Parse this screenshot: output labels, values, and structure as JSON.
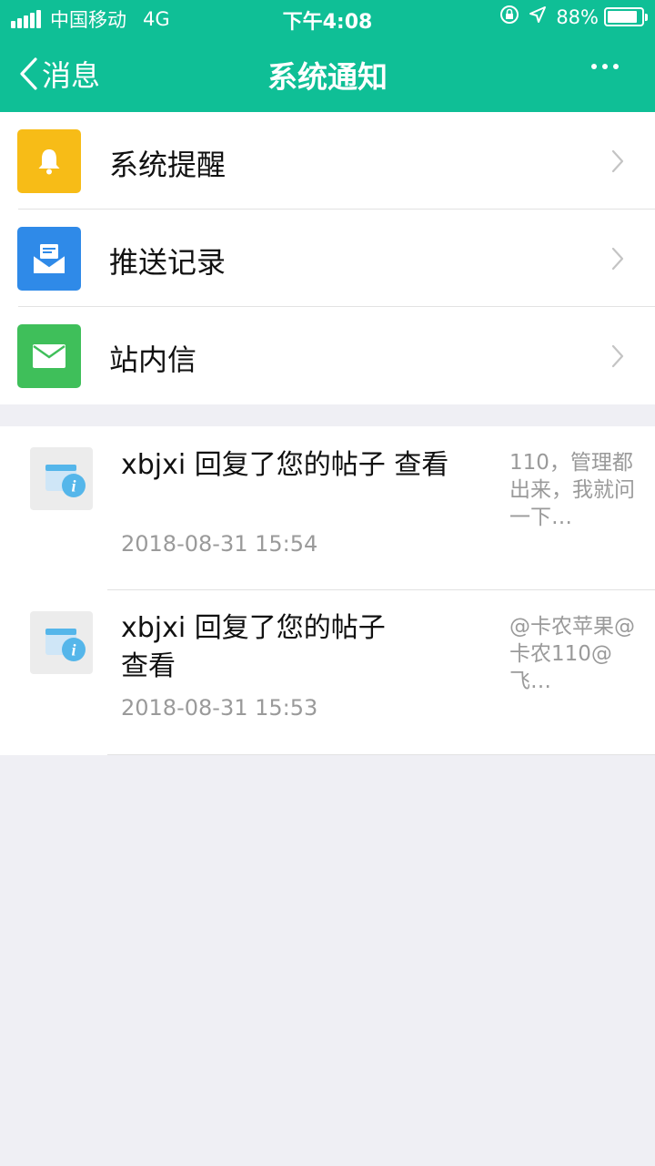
{
  "status_bar": {
    "carrier": "中国移动",
    "network": "4G",
    "time": "下午4:08",
    "battery_text": "88%",
    "battery_level": 0.88
  },
  "nav": {
    "back_label": "消息",
    "title": "系统通知"
  },
  "menu": [
    {
      "label": "系统提醒",
      "icon": "bell-icon",
      "color": "#f7bc17"
    },
    {
      "label": "推送记录",
      "icon": "push-envelope-icon",
      "color": "#2f8ae8"
    },
    {
      "label": "站内信",
      "icon": "mail-icon",
      "color": "#3fbf5a"
    }
  ],
  "notifications": [
    {
      "title": "xbjxi 回复了您的帖子 查看",
      "time": "2018-08-31 15:54",
      "preview": "110，管理都出来，我就问一下…",
      "icon": "info-window-icon"
    },
    {
      "title": "xbjxi 回复了您的帖子 查看",
      "time": "2018-08-31 15:53",
      "preview": "@卡农苹果@卡农110@飞…",
      "icon": "info-window-icon"
    }
  ],
  "colors": {
    "header": "#0fbf96",
    "background": "#efeff4"
  }
}
